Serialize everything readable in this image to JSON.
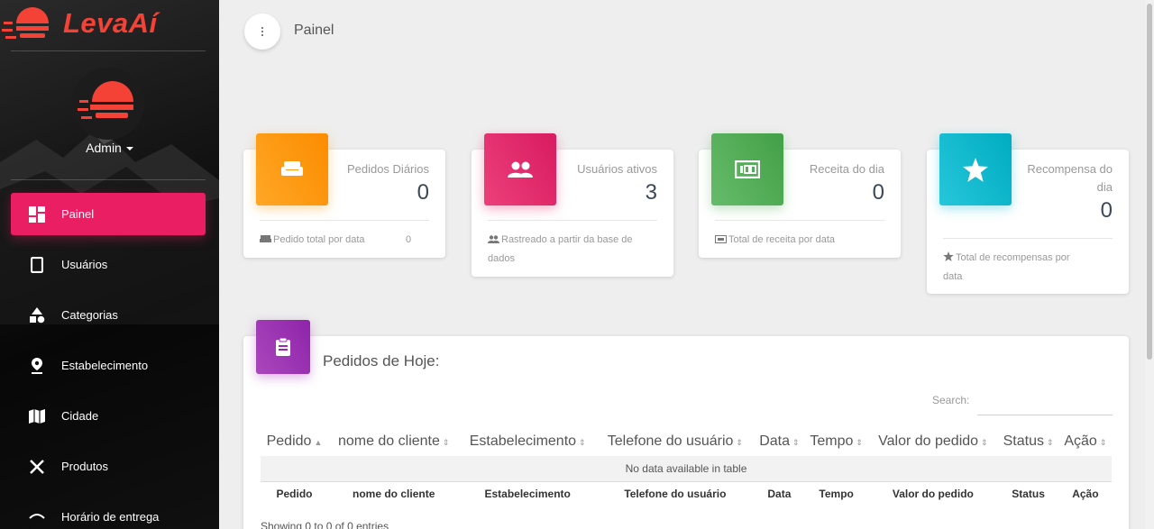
{
  "brand": {
    "name": "LevaAí"
  },
  "user": {
    "name": "Admin"
  },
  "sidebar": {
    "items": [
      {
        "label": "Painel",
        "icon": "dashboard-icon",
        "active": true
      },
      {
        "label": "Usuários",
        "icon": "phone-icon",
        "active": false
      },
      {
        "label": "Categorias",
        "icon": "category-icon",
        "active": false
      },
      {
        "label": "Estabelecimento",
        "icon": "location-pin-icon",
        "active": false
      },
      {
        "label": "Cidade",
        "icon": "map-icon",
        "active": false
      },
      {
        "label": "Produtos",
        "icon": "utensils-icon",
        "active": false
      },
      {
        "label": "Horário de entrega",
        "icon": "delivery-icon",
        "active": false
      }
    ]
  },
  "header": {
    "title": "Painel"
  },
  "stats": [
    {
      "title": "Pedidos Diários",
      "value": "0",
      "footer": "Pedido total por data",
      "footer_value": "0",
      "color": "#ff9800",
      "icon": "couch-icon"
    },
    {
      "title": "Usuários ativos",
      "value": "3",
      "footer": "Rastreado a partir da base de dados",
      "color": "#e91e63",
      "icon": "people-icon"
    },
    {
      "title": "Receita do dia",
      "value": "0",
      "footer": "Total de receita por data",
      "color": "#4caf50",
      "icon": "money-icon"
    },
    {
      "title": "Recompensa do dia",
      "value": "0",
      "footer": "Total de recompensas por data",
      "color": "#00bcd4",
      "icon": "star-icon"
    }
  ],
  "orders": {
    "title": "Pedidos de Hoje:",
    "search_label": "Search:",
    "columns": [
      "Pedido",
      "nome do cliente",
      "Estabelecimento",
      "Telefone do usuário",
      "Data",
      "Tempo",
      "Valor do pedido",
      "Status",
      "Ação"
    ],
    "empty_text": "No data available in table",
    "info": "Showing 0 to 0 of 0 entries"
  }
}
